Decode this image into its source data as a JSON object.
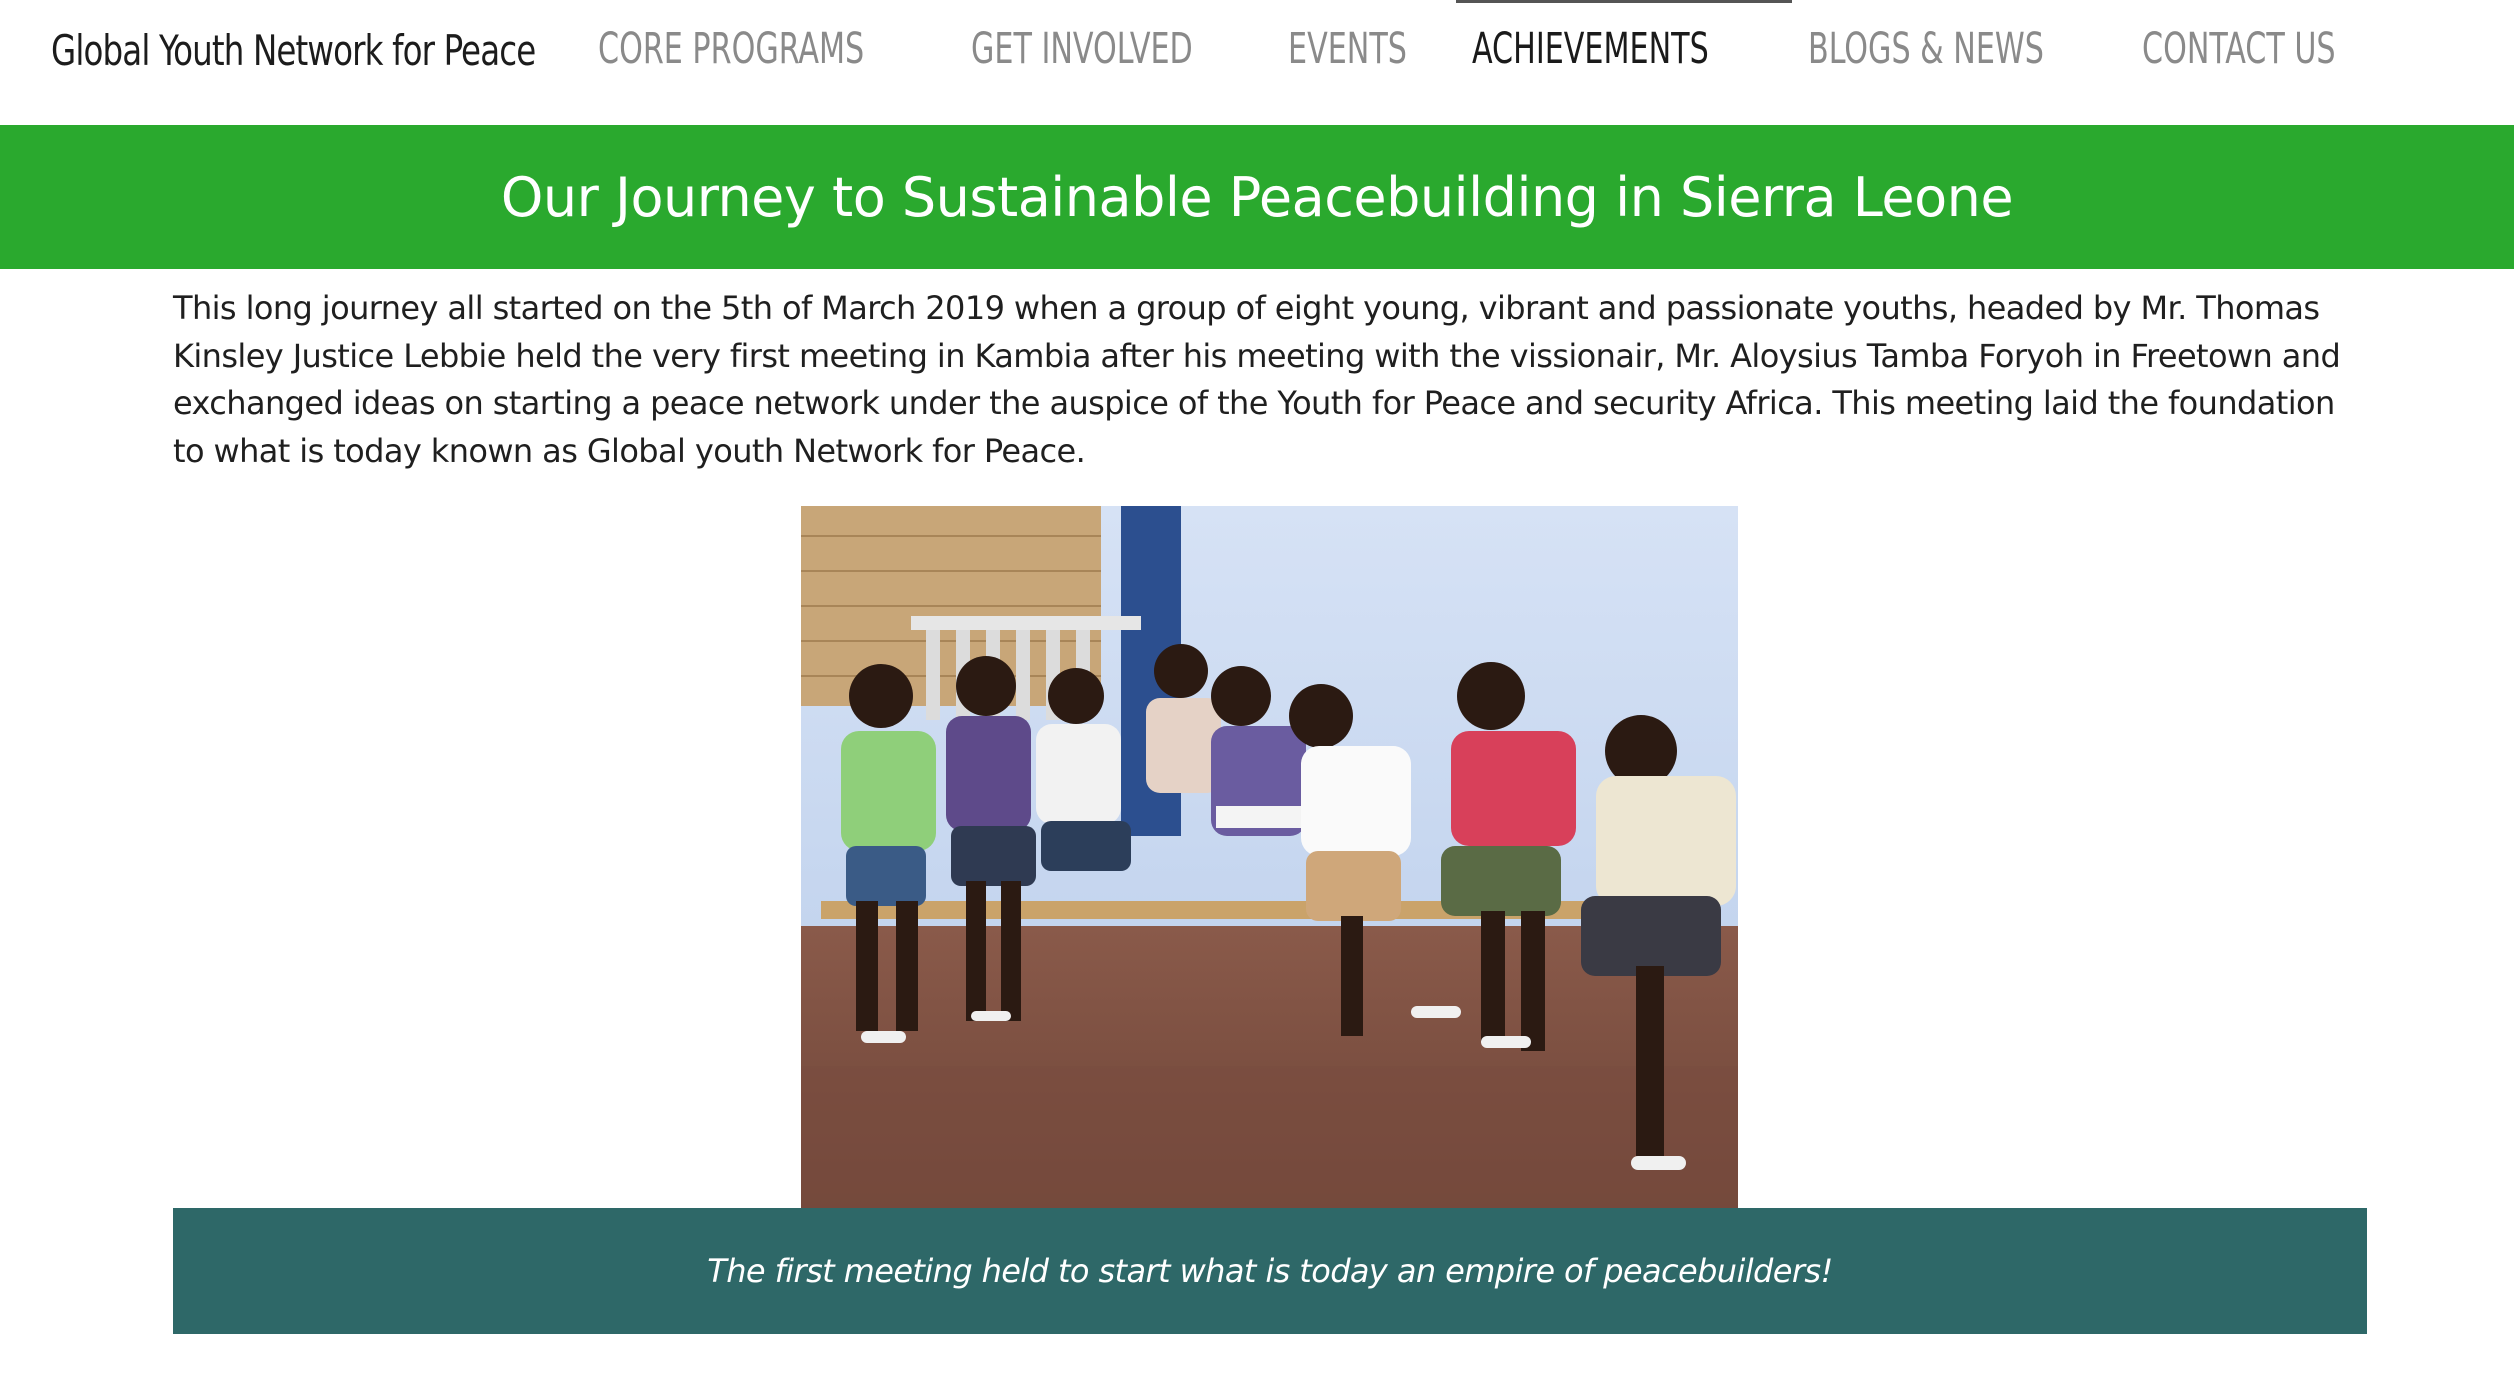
{
  "header": {
    "brand": "Global Youth Network for Peace",
    "nav": [
      {
        "label": "CORE PROGRAMS",
        "active": false
      },
      {
        "label": "GET INVOLVED",
        "active": false
      },
      {
        "label": "EVENTS",
        "active": false
      },
      {
        "label": "ACHIEVEMENTS",
        "active": true
      },
      {
        "label": "BLOGS & NEWS",
        "active": false
      },
      {
        "label": "CONTACT US",
        "active": false
      }
    ]
  },
  "banner": {
    "title": "Our Journey to Sustainable Peacebuilding in Sierra Leone",
    "background_color": "#2aa92e"
  },
  "article": {
    "intro": "This long journey all started on the 5th of March 2019 when a group of eight young, vibrant and passionate youths, headed by Mr. Thomas Kinsley Justice Lebbie held the very first meeting in Kambia after his meeting with the vissionair, Mr. Aloysius Tamba Foryoh in Freetown and exchanged ideas on starting a peace network under the auspice of the Youth for Peace and security Africa. This meeting laid the foundation to what is today known as Global youth Network for Peace.",
    "photo_caption": "The first meeting held to start what is today an empire of peacebuilders!",
    "caption_background_color": "#2e6868"
  }
}
